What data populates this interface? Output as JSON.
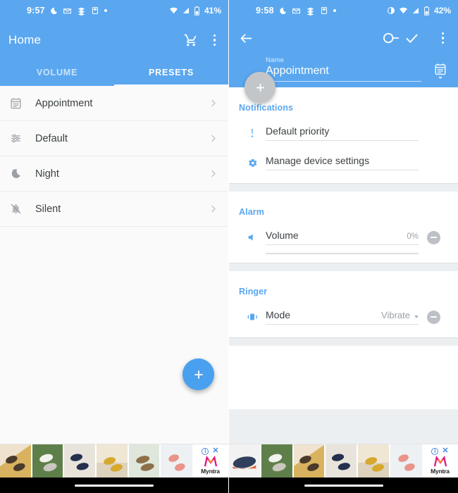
{
  "left": {
    "status": {
      "time": "9:57",
      "battery_pct": "41%",
      "icons_left": [
        "moon-dnd-icon",
        "mail-icon",
        "sololearn-icon",
        "notification-icon",
        "dot-icon"
      ],
      "icons_right": [
        "wifi-icon",
        "signal-icon",
        "battery-icon"
      ]
    },
    "appbar": {
      "title": "Home",
      "cart_label": "cart-icon",
      "overflow_label": "more-options-icon"
    },
    "tabs": [
      {
        "label": "VOLUME",
        "active": false
      },
      {
        "label": "PRESETS",
        "active": true
      }
    ],
    "presets": [
      {
        "label": "Appointment",
        "icon": "calendar-icon"
      },
      {
        "label": "Default",
        "icon": "sliders-icon"
      },
      {
        "label": "Night",
        "icon": "moon-icon"
      },
      {
        "label": "Silent",
        "icon": "bell-off-icon"
      }
    ],
    "fab": {
      "label": "+",
      "color": "#49a0ef"
    }
  },
  "right": {
    "status": {
      "time": "9:58",
      "battery_pct": "42%",
      "icons_left": [
        "moon-dnd-icon",
        "mail-icon",
        "sololearn-icon",
        "notification-icon",
        "dot-icon"
      ],
      "icons_right": [
        "contrast-icon",
        "wifi-icon",
        "signal-icon",
        "battery-icon"
      ]
    },
    "editbar": {
      "back_label": "back-arrow-icon",
      "toggle_state": "off",
      "confirm_label": "check-icon",
      "overflow_label": "more-options-icon",
      "name_label": "Name",
      "name_value": "Appointment",
      "name_icon": "calendar-picker-icon"
    },
    "fab": {
      "label": "+",
      "color": "#c3c6c8"
    },
    "sections": [
      {
        "title": "Notifications",
        "rows": [
          {
            "icon": "priority-icon",
            "label": "Default priority",
            "value": "",
            "has_remove": false,
            "has_slider": false
          },
          {
            "icon": "gear-icon",
            "label": "Manage device settings",
            "value": "",
            "has_remove": false,
            "has_slider": false
          }
        ]
      },
      {
        "title": "Alarm",
        "rows": [
          {
            "icon": "speaker-icon",
            "label": "Volume",
            "value": "0%",
            "has_remove": true,
            "has_slider": true
          }
        ]
      },
      {
        "title": "Ringer",
        "rows": [
          {
            "icon": "vibrate-icon",
            "label": "Mode",
            "value": "Vibrate",
            "has_remove": true,
            "has_slider": false,
            "is_dropdown": true
          }
        ]
      }
    ]
  },
  "ad": {
    "brand": "Myntra",
    "info_label": "i",
    "close_label": "✕",
    "left_thumbs": [
      "#7c6a5a",
      "#6b8f5a",
      "#2f3a52",
      "#c9a23a",
      "#8fa68c",
      "#e8a49a"
    ],
    "right_thumbs": [
      "#3a4a63",
      "#6b8f5a",
      "#7c6a5a",
      "#2f3a52",
      "#c9a23a",
      "#e8a49a"
    ]
  },
  "colors": {
    "primary": "#5aa7f0",
    "accent": "#49a0ef",
    "section_title": "#5aa7f0"
  }
}
